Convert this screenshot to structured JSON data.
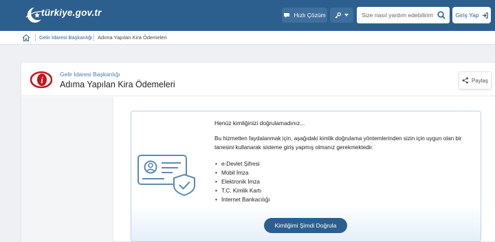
{
  "header": {
    "logo_text": "türkiye.gov.tr",
    "quick_solution_label": "Hızlı Çözüm",
    "tools_icon": "key-icon",
    "search_placeholder": "Size nasıl yardım edebilirim",
    "login_label": "Giriş Yap",
    "brand_color": "#2d5f8e"
  },
  "breadcrumb": {
    "home_icon": "home-icon",
    "items": [
      "Gelir İdaresi Başkanlığı",
      "Adıma Yapılan Kira Ödemeleri"
    ]
  },
  "service": {
    "organization": "Gelir İdaresi Başkanlığı",
    "title": "Adıma Yapılan Kira Ödemeleri",
    "share_label": "Paylaş"
  },
  "auth": {
    "title": "Henüz kimliğinizi doğrulamadınız...",
    "description": "Bu hizmetten faydalanmak için, aşağıdaki kimlik doğrulama yöntemlerinden sizin için uygun olan bir tanesini kullanarak sisteme giriş yapmış olmanız gerekmektedir.",
    "methods": [
      "e-Devlet Şifresi",
      "Mobil İmza",
      "Elektronik İmza",
      "T.C. Kimlik Kartı",
      "İnternet Bankacılığı"
    ],
    "verify_button": "Kimliğimi Şimdi Doğrula",
    "accent_color": "#5b8bb4"
  }
}
